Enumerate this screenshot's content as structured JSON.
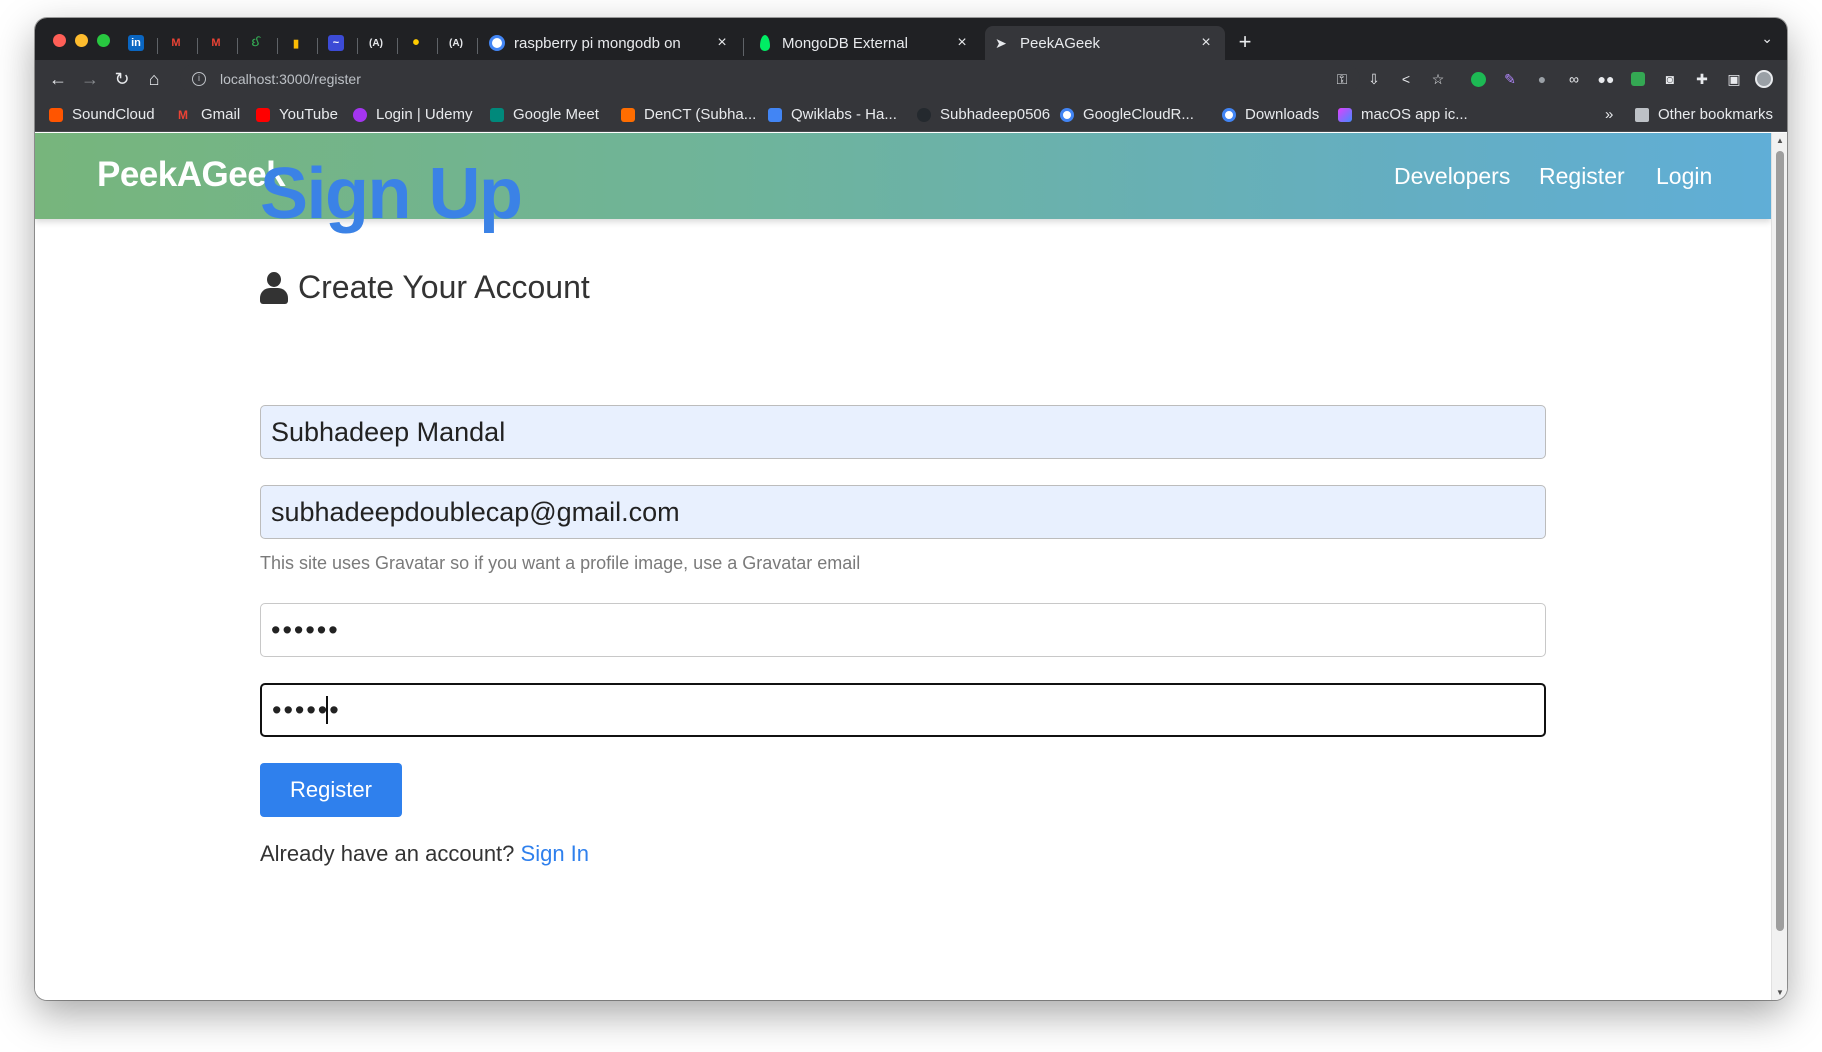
{
  "browser": {
    "pinned_tabs": [
      {
        "icon": "linkedin-icon",
        "glyph": "in",
        "color": "#0a66c2"
      },
      {
        "icon": "gmail-icon",
        "glyph": "M",
        "color": "#ea4335"
      },
      {
        "icon": "gmail-icon",
        "glyph": "M",
        "color": "#ea4335"
      },
      {
        "icon": "app-icon",
        "glyph": "ઈ",
        "color": "#34a853"
      },
      {
        "icon": "key-icon",
        "glyph": "▮",
        "color": "#fbbc04"
      },
      {
        "icon": "app-icon",
        "glyph": "~",
        "color": "#3c4bd6"
      },
      {
        "icon": "app-icon",
        "glyph": "(A)",
        "color": "#202124"
      },
      {
        "icon": "notification-icon",
        "glyph": "•",
        "color": "#ffcc00"
      },
      {
        "icon": "app-icon",
        "glyph": "(A)",
        "color": "#202124"
      }
    ],
    "tabs": [
      {
        "title": "raspberry pi mongodb on",
        "close": "×",
        "favicon_color": "#ffffff"
      },
      {
        "title": "MongoDB External",
        "close": "×",
        "favicon_color": "#00ed64"
      },
      {
        "title": "PeekAGeek",
        "close": "×",
        "favicon_color": "#e8eaed"
      }
    ],
    "new_tab": "+",
    "tab_search": "⌄",
    "address": "localhost:3000/register",
    "bookmarks": [
      {
        "label": "SoundCloud",
        "color": "#ff5500"
      },
      {
        "label": "Gmail",
        "color": "#ea4335"
      },
      {
        "label": "YouTube",
        "color": "#ff0000"
      },
      {
        "label": "Login | Udemy",
        "color": "#a435f0"
      },
      {
        "label": "Google Meet",
        "color": "#00897b"
      },
      {
        "label": "DenCT (Subha...",
        "color": "#ff6d00"
      },
      {
        "label": "Qwiklabs - Ha...",
        "color": "#4285f4"
      },
      {
        "label": "Subhadeep0506",
        "color": "#24292e"
      },
      {
        "label": "GoogleCloudR...",
        "color": "#4285f4"
      },
      {
        "label": "Downloads",
        "color": "#4285f4"
      },
      {
        "label": "macOS app ic...",
        "color": "#e040fb"
      }
    ],
    "bookmarks_overflow": "»",
    "other_bookmarks": "Other bookmarks"
  },
  "navbar": {
    "brand": "PeekAGeek",
    "links": [
      "Developers",
      "Register",
      "Login"
    ]
  },
  "form": {
    "title": "Sign Up",
    "subtitle": "Create Your Account",
    "name_value": "Subhadeep Mandal",
    "email_value": "subhadeepdoublecap@gmail.com",
    "email_help": "This site uses Gravatar so if you want a profile image, use a Gravatar email",
    "password_value": "••••••",
    "password2_value": "••••••",
    "submit_label": "Register",
    "signin_prompt": "Already have an account?",
    "signin_link": "Sign In"
  },
  "colors": {
    "accent": "#2f80ed",
    "title_blue": "#3b82e6",
    "navbar_start": "#77b57c",
    "navbar_end": "#60aed7"
  }
}
